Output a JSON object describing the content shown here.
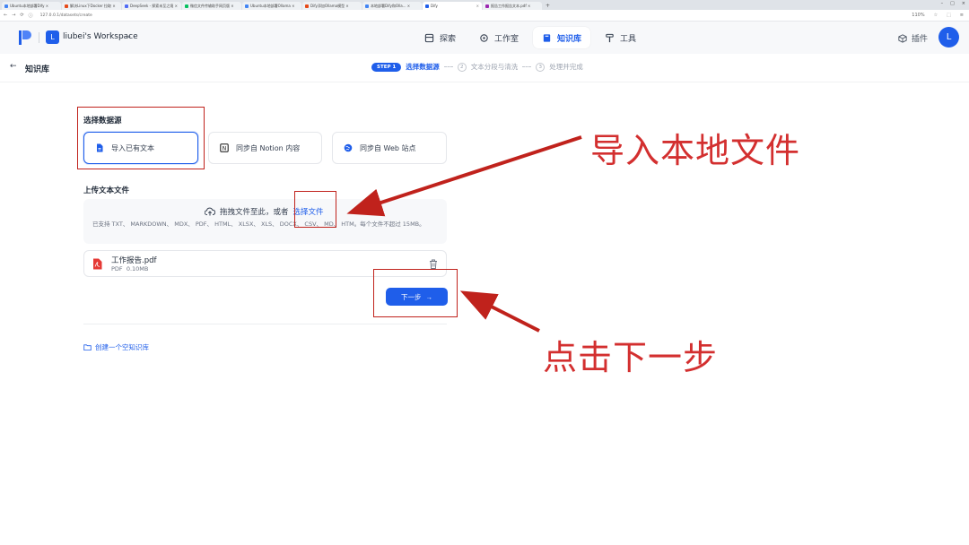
{
  "browser": {
    "tabs": [
      {
        "label": "Ubuntu本地部署Dify ×",
        "color": "#4285f4"
      },
      {
        "label": "解决Linux下Docker 拉取 ×",
        "color": "#e64a19"
      },
      {
        "label": "DeepSeek - 探索未至之境 ×",
        "color": "#4f6bf5"
      },
      {
        "label": "微信文件传输助手网页版 ×",
        "color": "#07c160"
      },
      {
        "label": "Ubuntu本地部署Ollama ×",
        "color": "#4285f4"
      },
      {
        "label": "Dify添加Ollama模型 ×",
        "color": "#e64a19"
      },
      {
        "label": "本地部署Dify和Olla... ×",
        "color": "#4285f4"
      },
      {
        "label": "Dify",
        "color": "#1f5eea"
      },
      {
        "label": "报告工作报告文本.pdf ×",
        "color": "#9c27b0"
      }
    ],
    "url": "127.0.0.1/datasets/create",
    "zoom": "110%"
  },
  "header": {
    "workspace_initial": "L",
    "workspace_name": "liubei's Workspace",
    "nav": {
      "explore": "探索",
      "studio": "工作室",
      "knowledge": "知识库",
      "tools": "工具"
    },
    "plugins": "插件",
    "avatar_initial": "L"
  },
  "subheader": {
    "back_title": "知识库",
    "steps": {
      "step1_pill": "STEP 1",
      "step1_label": "选择数据源",
      "step2_num": "2",
      "step2_label": "文本分段与清洗",
      "step3_num": "3",
      "step3_label": "处理并完成"
    }
  },
  "main": {
    "datasource_title": "选择数据源",
    "sources": {
      "local": "导入已有文本",
      "notion": "同步自 Notion 内容",
      "web": "同步自 Web 站点"
    },
    "upload_title": "上传文本文件",
    "dropzone": {
      "text": "拖拽文件至此，或者",
      "link": "选择文件",
      "hint": "已支持 TXT、 MARKDOWN、 MDX、 PDF、 HTML、 XLSX、 XLS、 DOCX、 CSV、 MD、 HTM。每个文件不超过 15MB。"
    },
    "file": {
      "name": "工作报告.pdf",
      "type": "PDF",
      "size": "0.10MB"
    },
    "next_button": "下一步",
    "create_empty": "创建一个空知识库"
  },
  "annotations": {
    "import_local": "导入本地文件",
    "click_next": "点击下一步"
  },
  "colors": {
    "brand": "#1f5eea",
    "annotation": "#c0221c"
  }
}
